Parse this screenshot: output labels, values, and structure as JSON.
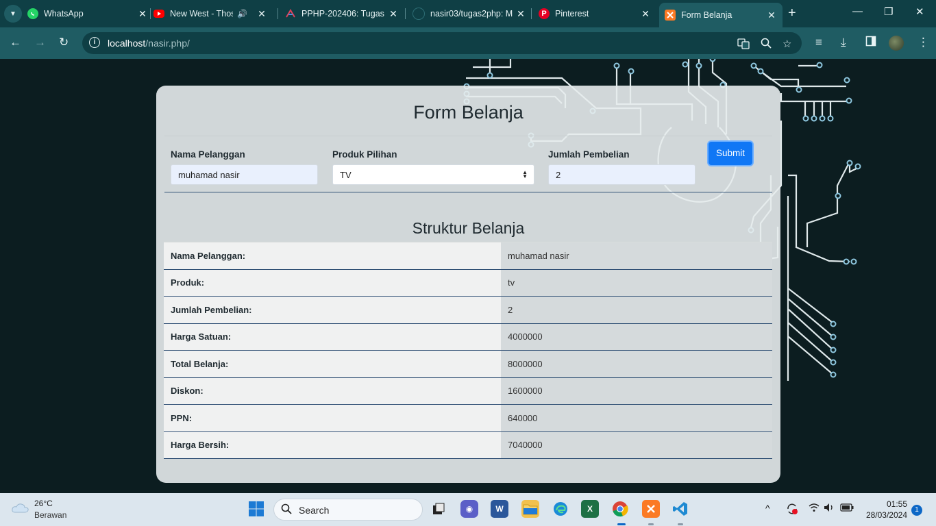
{
  "browser": {
    "tabs": [
      {
        "title": "WhatsApp",
        "icon": "whatsapp-icon"
      },
      {
        "title": "New West - Those",
        "icon": "youtube-icon",
        "extra_icon": "speaker-icon"
      },
      {
        "title": "PPHP-202406: Tugas",
        "icon": "project-icon"
      },
      {
        "title": "nasir03/tugas2php: M",
        "icon": "github-icon"
      },
      {
        "title": "Pinterest",
        "icon": "pinterest-icon"
      },
      {
        "title": "Form Belanja",
        "icon": "xampp-icon",
        "active": true
      }
    ],
    "url_host": "localhost",
    "url_path": "/nasir.php/"
  },
  "form": {
    "title": "Form Belanja",
    "fields": {
      "nama_label": "Nama Pelanggan",
      "nama_value": "muhamad nasir",
      "produk_label": "Produk Pilihan",
      "produk_value": "TV",
      "jumlah_label": "Jumlah Pembelian",
      "jumlah_value": "2"
    },
    "submit_label": "Submit"
  },
  "struktur": {
    "title": "Struktur Belanja",
    "rows": [
      {
        "label": "Nama Pelanggan:",
        "value": "muhamad nasir"
      },
      {
        "label": "Produk:",
        "value": "tv"
      },
      {
        "label": "Jumlah Pembelian:",
        "value": "2"
      },
      {
        "label": "Harga Satuan:",
        "value": "4000000"
      },
      {
        "label": "Total Belanja:",
        "value": "8000000"
      },
      {
        "label": "Diskon:",
        "value": "1600000"
      },
      {
        "label": "PPN:",
        "value": "640000"
      },
      {
        "label": "Harga Bersih:",
        "value": "7040000"
      }
    ]
  },
  "taskbar": {
    "weather_temp": "26°C",
    "weather_condition": "Berawan",
    "search_placeholder": "Search",
    "time": "01:55",
    "date": "28/03/2024",
    "notification_count": "1"
  },
  "colors": {
    "tab_strip": "#0f3f45",
    "toolbar": "#1f5c63",
    "page_background": "#0c1d20",
    "submit_button": "#1077f5",
    "table_border": "#2f4f74"
  }
}
